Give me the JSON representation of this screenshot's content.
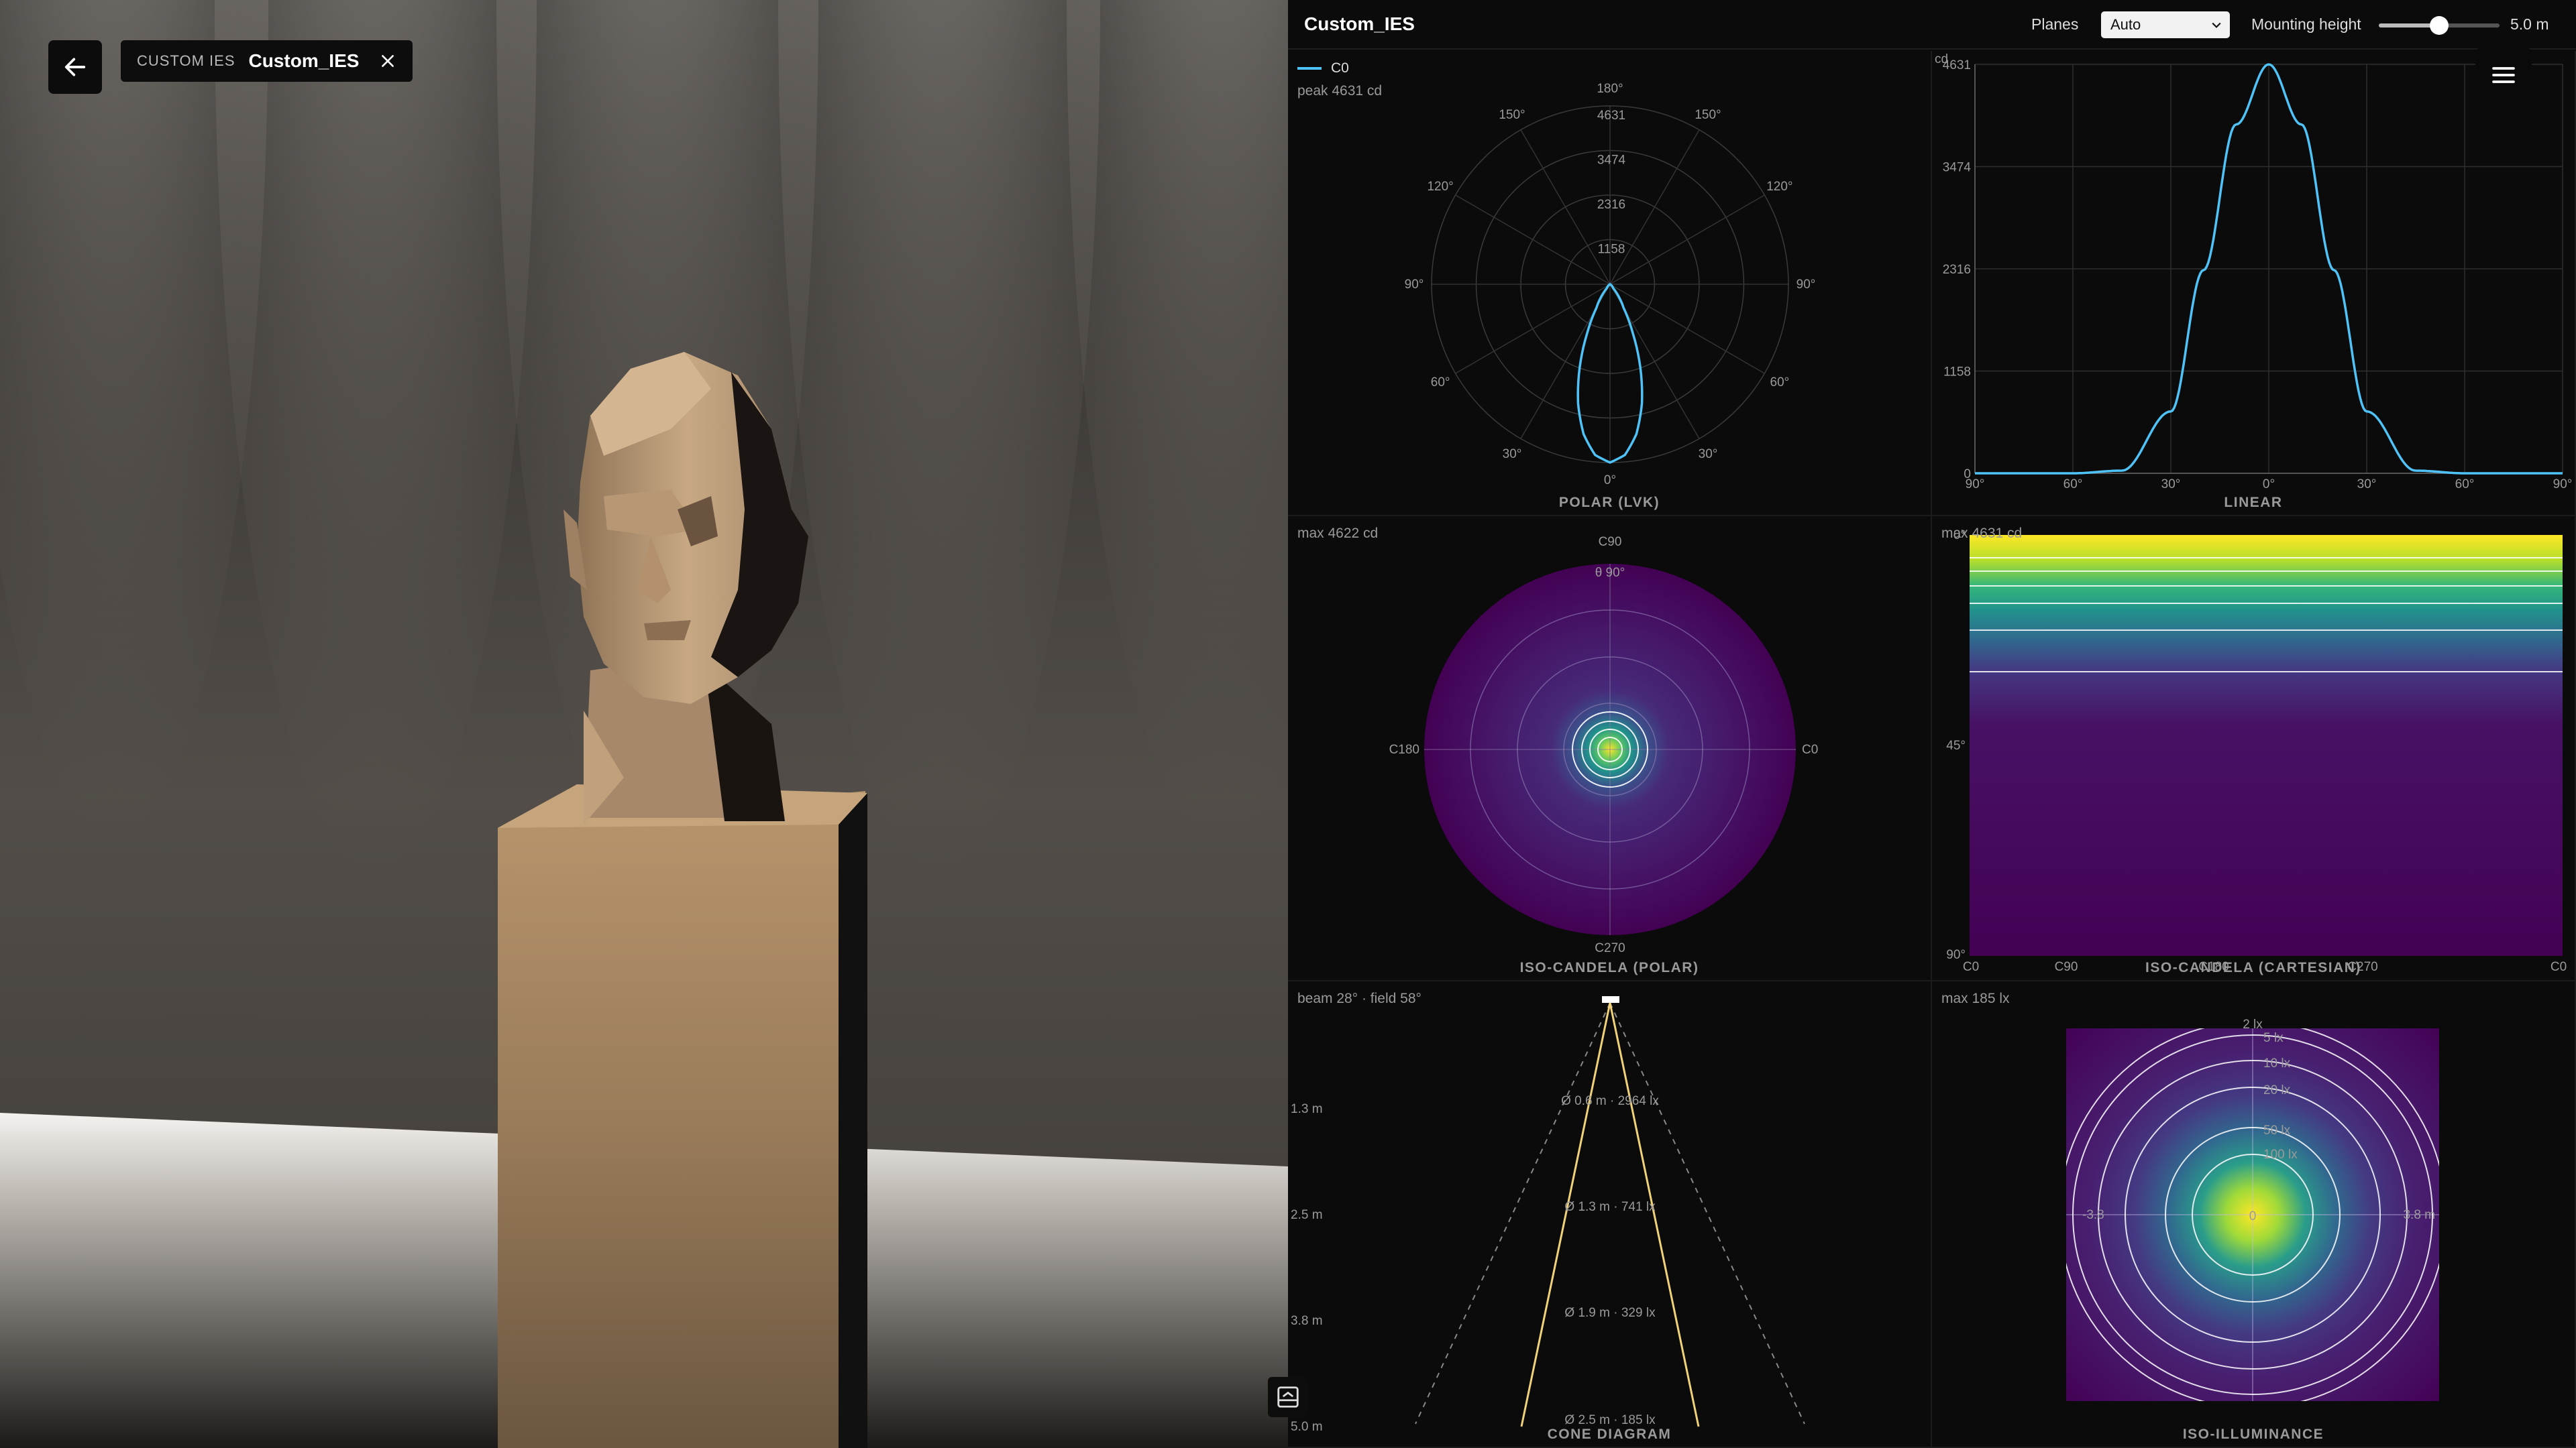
{
  "viewport": {
    "back_icon": "arrow-left-icon",
    "file_kind": "CUSTOM IES",
    "file_name": "Custom_IES",
    "close_icon": "close-icon",
    "panel_toggle_icon": "panel-toggle-icon"
  },
  "panel": {
    "title": "Custom_IES",
    "planes_label": "Planes",
    "planes_value": "Auto",
    "mounting_label": "Mounting height",
    "mounting_value": "5.0 m",
    "mounting_fraction": 0.5,
    "menu_icon": "hamburger-menu-icon"
  },
  "polar": {
    "legend": "C0",
    "peak": "peak 4631 cd",
    "caption": "POLAR (LVK)",
    "rings": [
      "1158",
      "2316",
      "3474",
      "4631"
    ],
    "angles": [
      "180°",
      "150°",
      "150°",
      "120°",
      "120°",
      "90°",
      "90°",
      "60°",
      "60°",
      "30°",
      "30°",
      "0°"
    ],
    "color": "#4fc3f7"
  },
  "linear": {
    "caption": "LINEAR",
    "unit": "cd",
    "y_ticks": [
      "4631",
      "3474",
      "2316",
      "1158",
      "0"
    ],
    "x_ticks": [
      "90°",
      "60°",
      "30°",
      "0°",
      "30°",
      "60°",
      "90°"
    ]
  },
  "iso_polar": {
    "note": "max 4622 cd",
    "caption": "ISO-CANDELA (POLAR)",
    "top": "C90",
    "left": "C180",
    "right": "C0",
    "bottom": "C270",
    "theta": "θ 90°"
  },
  "iso_cart": {
    "note": "max 4631 cd",
    "caption": "ISO-CANDELA (CARTESIAN)",
    "y_ticks": [
      "0°",
      "45°",
      "90°"
    ],
    "x_ticks": [
      "C0",
      "C90",
      "C180",
      "C270",
      "C0"
    ]
  },
  "cone": {
    "note": "beam 28° · field 58°",
    "caption": "CONE DIAGRAM",
    "distances": [
      "1.3 m",
      "2.5 m",
      "3.8 m",
      "5.0 m"
    ],
    "labels": [
      "Ø 0.6 m · 2964 lx",
      "Ø 1.3 m · 741 lx",
      "Ø 1.9 m · 329 lx",
      "Ø 2.5 m · 185 lx"
    ]
  },
  "iso_lux": {
    "note": "max 185 lx",
    "caption": "ISO-ILLUMINANCE",
    "contours": [
      "2 lx",
      "5 lx",
      "10 lx",
      "20 lx",
      "50 lx",
      "100 lx"
    ],
    "left": "-3.8",
    "right": "3.8 m",
    "center": "0"
  },
  "chart_data": [
    {
      "type": "line",
      "title": "POLAR (LVK)",
      "series": [
        {
          "name": "C0",
          "x": [
            0,
            5,
            10,
            15,
            20,
            25,
            30,
            40,
            60,
            90,
            180
          ],
          "values": [
            4631,
            4450,
            3950,
            3200,
            2300,
            1400,
            700,
            120,
            0,
            0,
            0
          ]
        }
      ],
      "ylim": [
        0,
        4631
      ]
    },
    {
      "type": "line",
      "title": "LINEAR",
      "x": [
        -90,
        -60,
        -45,
        -30,
        -20,
        -10,
        0,
        10,
        20,
        30,
        45,
        60,
        90
      ],
      "values": [
        0,
        0,
        30,
        700,
        2300,
        3950,
        4631,
        3950,
        2300,
        700,
        30,
        0,
        0
      ],
      "ylim": [
        0,
        4631
      ],
      "xlim": [
        -90,
        90
      ]
    }
  ]
}
